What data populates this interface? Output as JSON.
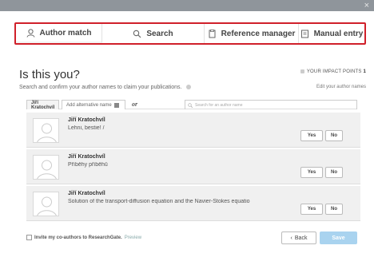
{
  "window": {
    "close_glyph": "×"
  },
  "tabs": [
    {
      "label": "Author match",
      "icon": "person-icon"
    },
    {
      "label": "Search",
      "icon": "search-icon"
    },
    {
      "label": "Reference manager",
      "icon": "document-icon"
    },
    {
      "label": "Manual entry",
      "icon": "page-icon"
    }
  ],
  "header": {
    "title": "Is this you?",
    "impact_label": "YOUR IMPACT POINTS",
    "impact_value": "1",
    "subtitle": "Search and confirm your author names to claim your publications.",
    "edit_names": "Edit your author names"
  },
  "names": {
    "current": "Jiří Kratochvíl",
    "add_label": "Add alternative name",
    "or_label": "or",
    "search_placeholder": "Search for an author name"
  },
  "matches": [
    {
      "name": "Jiří Kratochvíl",
      "publication": "Lehni, bestie! /",
      "yes": "Yes",
      "no": "No"
    },
    {
      "name": "Jiří Kratochvíl",
      "publication": "Příběhy příběhů",
      "yes": "Yes",
      "no": "No"
    },
    {
      "name": "Jiří Kratochvíl",
      "publication": "Solution of the transport-diffusion equation and the Navier-Stokes equatio",
      "yes": "Yes",
      "no": "No"
    }
  ],
  "footer": {
    "invite_label": "Invite my co-authors to ResearchGate.",
    "preview_label": "Preview",
    "back_label": "Back",
    "back_glyph": "‹",
    "save_label": "Save"
  },
  "colors": {
    "highlight_border": "#d0202a",
    "save_button": "#a9d3ef",
    "topbar": "#8f959b"
  }
}
